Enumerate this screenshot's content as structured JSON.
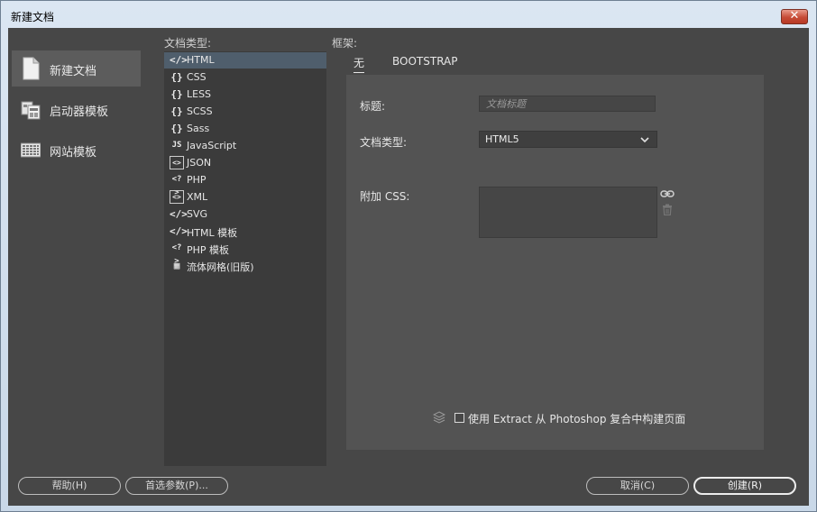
{
  "window": {
    "title": "新建文档",
    "close": "✕"
  },
  "left_nav": {
    "items": [
      {
        "label": "新建文档",
        "icon": "document-icon"
      },
      {
        "label": "启动器模板",
        "icon": "starter-template-icon"
      },
      {
        "label": "网站模板",
        "icon": "site-template-icon"
      }
    ]
  },
  "doc_types": {
    "header": "文档类型:",
    "items": [
      {
        "label": "HTML",
        "glyph": "</>"
      },
      {
        "label": "CSS",
        "glyph": "{}"
      },
      {
        "label": "LESS",
        "glyph": "{}"
      },
      {
        "label": "SCSS",
        "glyph": "{}"
      },
      {
        "label": "Sass",
        "glyph": "{}"
      },
      {
        "label": "JavaScript",
        "glyph": "JS"
      },
      {
        "label": "JSON",
        "glyph": "<>"
      },
      {
        "label": "PHP",
        "glyph": "<?>"
      },
      {
        "label": "XML",
        "glyph": "<>"
      },
      {
        "label": "SVG",
        "glyph": "</>"
      },
      {
        "label": "HTML 模板",
        "glyph": "</>"
      },
      {
        "label": "PHP 模板",
        "glyph": "<?>"
      },
      {
        "label": "流体网格(旧版)",
        "glyph": "▦"
      }
    ]
  },
  "framework": {
    "header": "框架:",
    "tabs": [
      {
        "label": "无"
      },
      {
        "label": "BOOTSTRAP"
      }
    ],
    "title_label": "标题:",
    "title_placeholder": "文档标题",
    "doctype_label": "文档类型:",
    "doctype_value": "HTML5",
    "css_label": "附加 CSS:",
    "extract_label": "使用 Extract 从 Photoshop 复合中构建页面"
  },
  "buttons": {
    "help": "帮助(H)",
    "prefs": "首选参数(P)...",
    "cancel": "取消(C)",
    "create": "创建(R)"
  },
  "colors": {
    "panel_bg": "#474747",
    "selected_row": "#4f5e6c",
    "close_red": "#c64b36"
  }
}
